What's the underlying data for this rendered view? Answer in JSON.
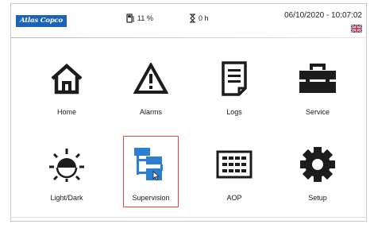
{
  "status_bar": {
    "brand": "Atlas Copco",
    "fuel_level": "11 %",
    "timer": "0 h",
    "datetime": "06/10/2020 - 10:07:02",
    "language_flag": "uk-flag-icon"
  },
  "menu": {
    "tiles": [
      {
        "label": "Home",
        "icon": "home-icon"
      },
      {
        "label": "Alarms",
        "icon": "alarm-warning-icon"
      },
      {
        "label": "Logs",
        "icon": "log-document-icon"
      },
      {
        "label": "Service",
        "icon": "toolbox-icon"
      },
      {
        "label": "Light/Dark",
        "icon": "brightness-icon"
      },
      {
        "label": "Supervision",
        "icon": "network-supervision-icon",
        "selected": true
      },
      {
        "label": "AOP",
        "icon": "keypad-grid-icon"
      },
      {
        "label": "Setup",
        "icon": "gear-icon"
      }
    ]
  },
  "colors": {
    "brand_blue": "#1b63b5",
    "icon_dark": "#1c1c1c",
    "supervision_blue": "#2a7fd1",
    "selection_border": "#e04848"
  }
}
